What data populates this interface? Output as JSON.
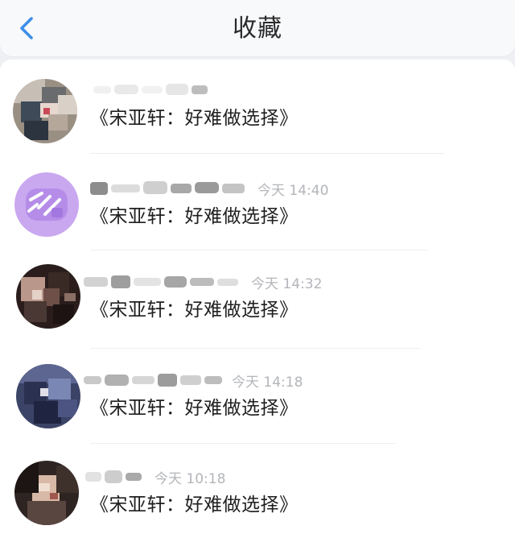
{
  "header": {
    "title": "收藏",
    "back_icon": "chevron-left-icon",
    "back_color": "#3d8fe8"
  },
  "favorites": [
    {
      "message": "《宋亚轩：好难做选择》",
      "time": ""
    },
    {
      "message": "《宋亚轩：好难做选择》",
      "time": "今天 14:40"
    },
    {
      "message": "《宋亚轩：好难做选择》",
      "time": "今天 14:32"
    },
    {
      "message": "《宋亚轩：好难做选择》",
      "time": "今天 14:18"
    },
    {
      "message": "《宋亚轩：好难做选择》",
      "time": "今天 10:18"
    }
  ]
}
